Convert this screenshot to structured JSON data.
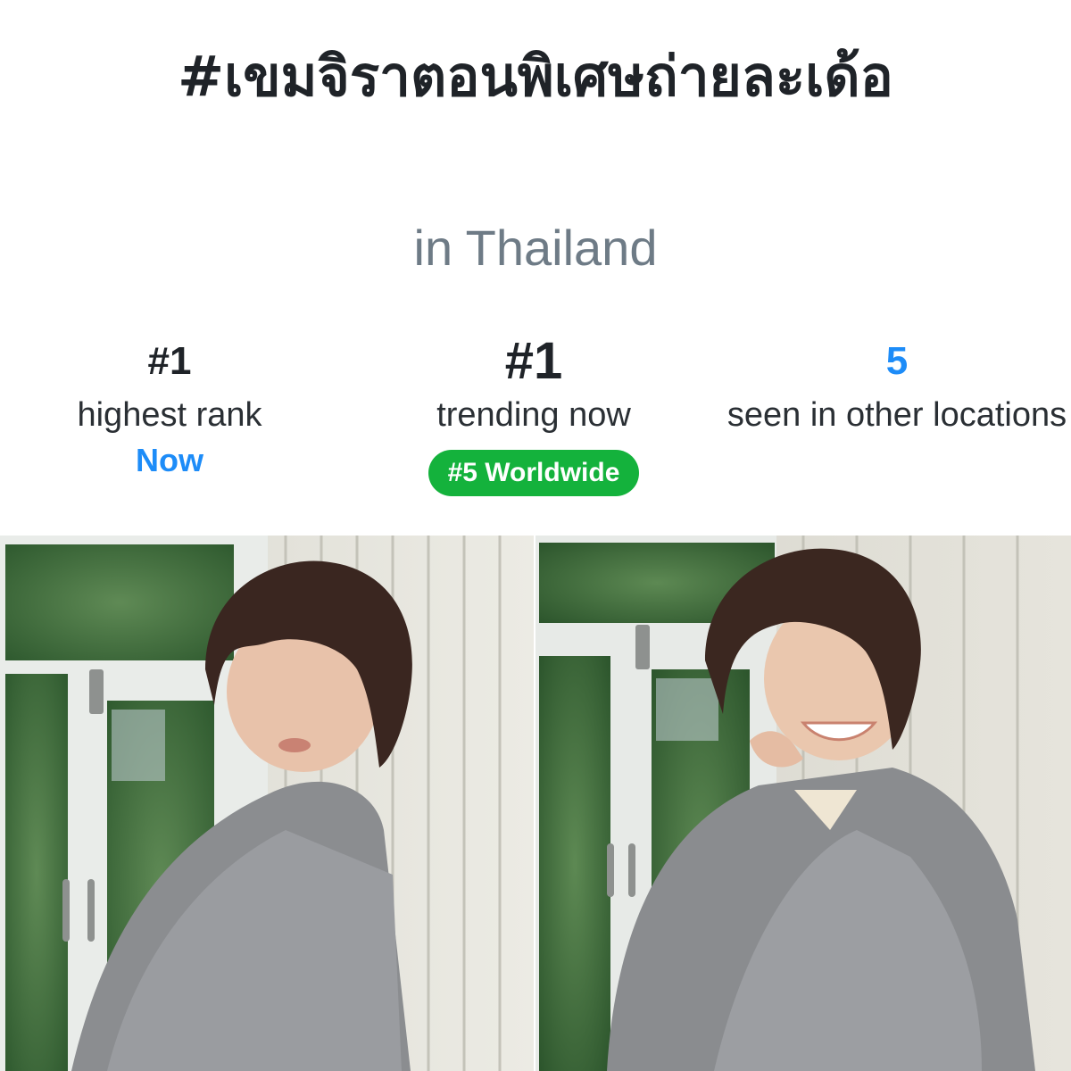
{
  "trend": {
    "hashtag": "#เขมจิราตอนพิเศษถ่ายละเด้อ",
    "location": "in Thailand"
  },
  "stats": [
    {
      "value": "#1",
      "label": "highest rank",
      "sub": "Now"
    },
    {
      "value": "#1",
      "label": "trending now",
      "badge": "#5 Worldwide"
    },
    {
      "value": "5",
      "label": "seen in other locations"
    }
  ],
  "colors": {
    "accent_blue": "#1d8cf8",
    "badge_green": "#14b23c",
    "text_dark": "#1f2328",
    "text_muted": "#6e7b86"
  },
  "photos": [
    {
      "subject": "person-in-grey-robe-looking-back"
    },
    {
      "subject": "person-in-grey-robe-smiling"
    }
  ]
}
